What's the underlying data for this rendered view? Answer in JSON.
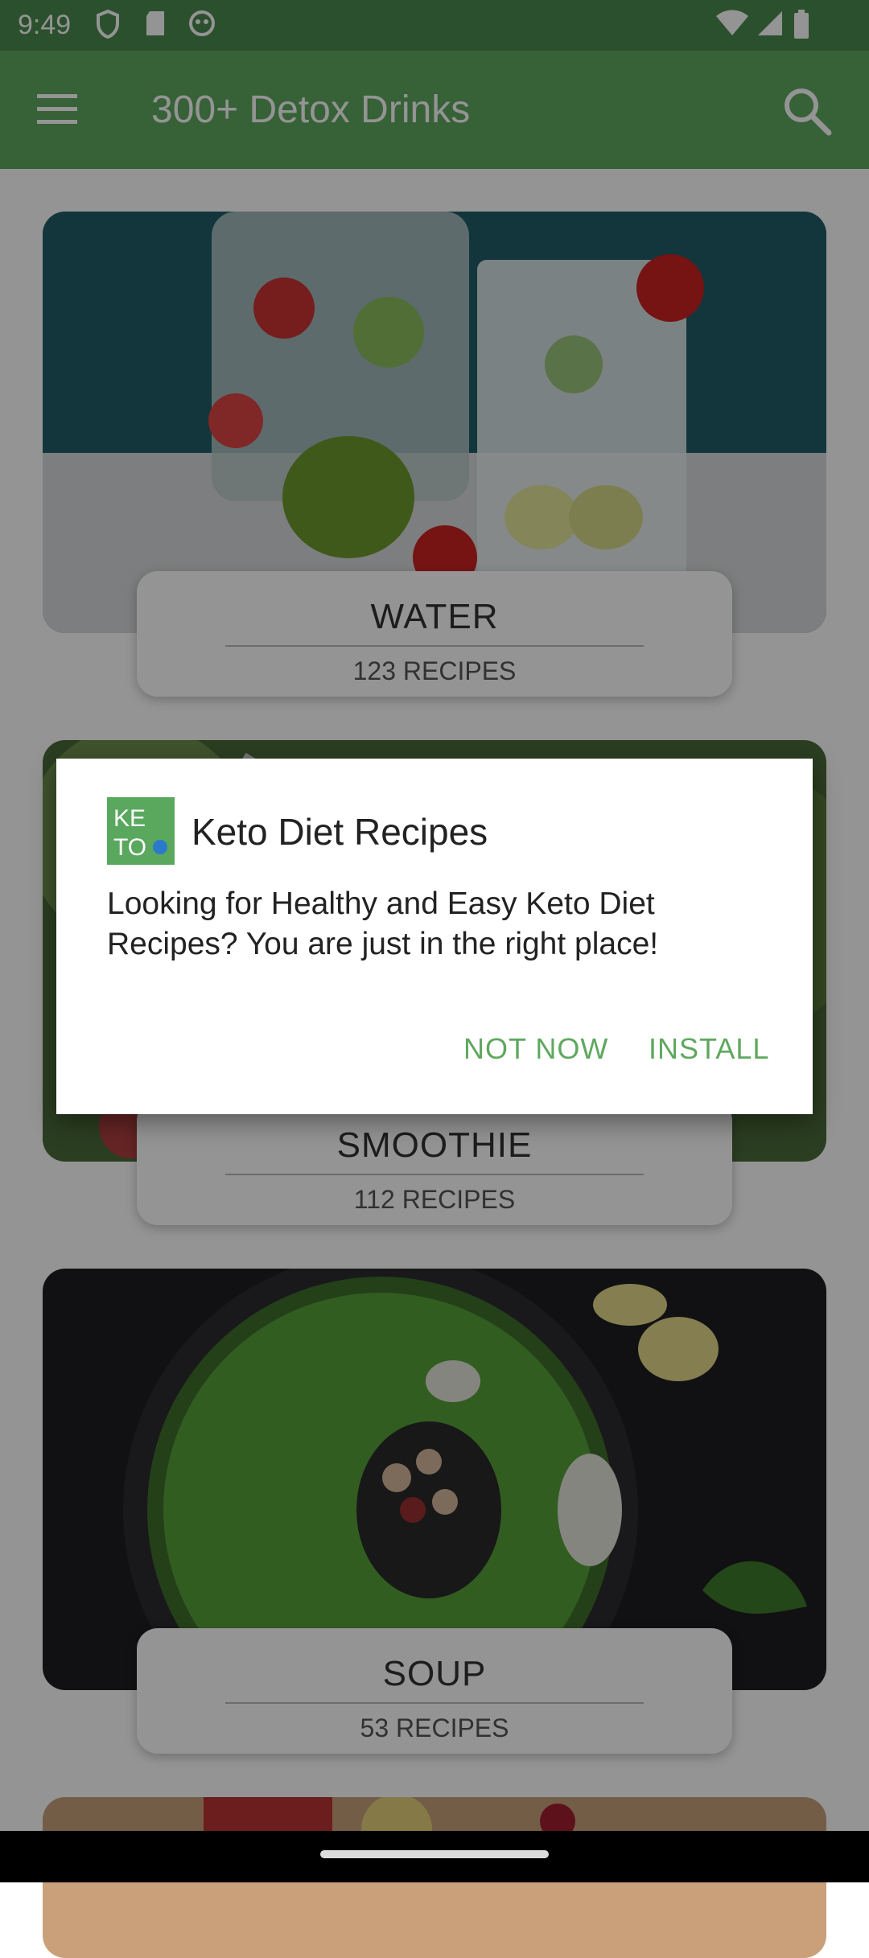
{
  "status_bar": {
    "time": "9:49"
  },
  "app_bar": {
    "title": "300+ Detox Drinks"
  },
  "categories": [
    {
      "name": "WATER",
      "count": "123 RECIPES"
    },
    {
      "name": "SMOOTHIE",
      "count": "112 RECIPES"
    },
    {
      "name": "SOUP",
      "count": "53 RECIPES"
    }
  ],
  "dialog": {
    "app_name": "Keto Diet Recipes",
    "logo_text_1": "KE",
    "logo_text_2": "TO",
    "message": "Looking for Healthy and Easy Keto Diet Recipes? You are just in the right place!",
    "not_now_label": "NOT NOW",
    "install_label": "INSTALL"
  },
  "colors": {
    "accent": "#5fa85f",
    "status_bar": "#4a8a4e"
  }
}
